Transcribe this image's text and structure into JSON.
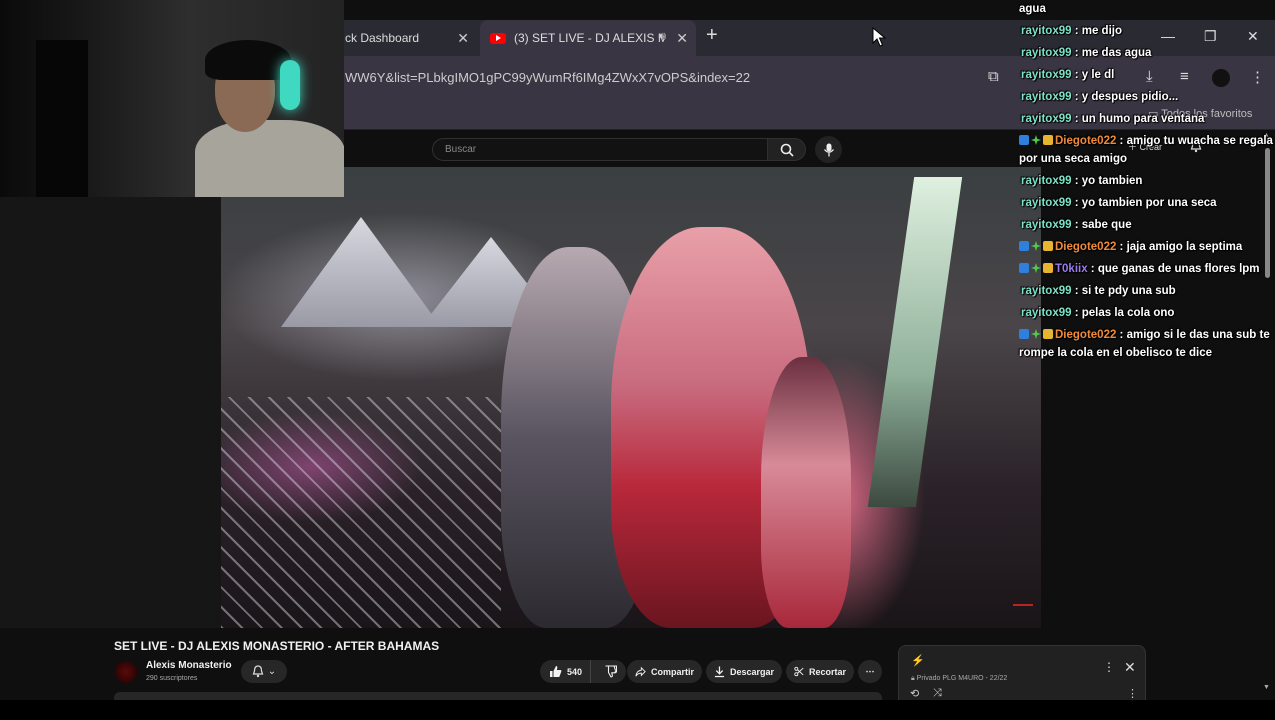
{
  "browser": {
    "tabs": [
      {
        "label": "ck Dashboard",
        "active": false
      },
      {
        "label": "(3) SET LIVE - DJ ALEXIS MC",
        "active": true
      }
    ],
    "url": "WW6Y&list=PLbkgIMO1gPC99yWumRf6IMg4ZWxX7vOPS&index=22",
    "bookmarks_label": "Todos los favoritos"
  },
  "youtube": {
    "search_placeholder": "Buscar",
    "create_label": "Crear",
    "video_title": "SET LIVE - DJ ALEXIS MONASTERIO - AFTER BAHAMAS",
    "channel_name": "Alexis Monasterio",
    "subscribers": "290 suscriptores",
    "likes": "540",
    "share_label": "Compartir",
    "download_label": "Descargar",
    "clip_label": "Recortar",
    "playlist": {
      "meta": "Privado PLG M4URO - 22/22"
    }
  },
  "chat": [
    {
      "user": "",
      "text": "agua",
      "badges": false,
      "color": "rayito"
    },
    {
      "user": "rayitox99",
      "text": ": me dijo",
      "badges": false,
      "color": "rayito"
    },
    {
      "user": "rayitox99",
      "text": ": me das agua",
      "badges": false,
      "color": "rayito"
    },
    {
      "user": "rayitox99",
      "text": ": y le dl",
      "badges": false,
      "color": "rayito"
    },
    {
      "user": "rayitox99",
      "text": ": y despues pidio...",
      "badges": false,
      "color": "rayito"
    },
    {
      "user": "rayitox99",
      "text": ": un humo para ventana",
      "badges": false,
      "color": "rayito"
    },
    {
      "user": "Diegote022",
      "text": ": amigo tu wuacha se regala por una seca amigo",
      "badges": true,
      "color": "diego"
    },
    {
      "user": "rayitox99",
      "text": ": yo tambien",
      "badges": false,
      "color": "rayito"
    },
    {
      "user": "rayitox99",
      "text": ": yo tambien por una seca",
      "badges": false,
      "color": "rayito"
    },
    {
      "user": "rayitox99",
      "text": ": sabe que",
      "badges": false,
      "color": "rayito"
    },
    {
      "user": "Diegote022",
      "text": ": jaja amigo la septima",
      "badges": true,
      "color": "diego"
    },
    {
      "user": "T0kiix",
      "text": ": que ganas de unas flores lpm",
      "badges": true,
      "color": "tokiix"
    },
    {
      "user": "rayitox99",
      "text": ": si te pdy una sub",
      "badges": false,
      "color": "rayito"
    },
    {
      "user": "rayitox99",
      "text": ": pelas la cola ono",
      "badges": false,
      "color": "rayito"
    },
    {
      "user": "Diegote022",
      "text": ": amigo si le das una sub te rompe la cola en el obelisco te dice",
      "badges": true,
      "color": "diego"
    }
  ],
  "colors": {
    "rayito": "#7fe2c8",
    "diego": "#f08a3a",
    "tokiix": "#9b79f0",
    "accent_red": "#ff0000"
  }
}
